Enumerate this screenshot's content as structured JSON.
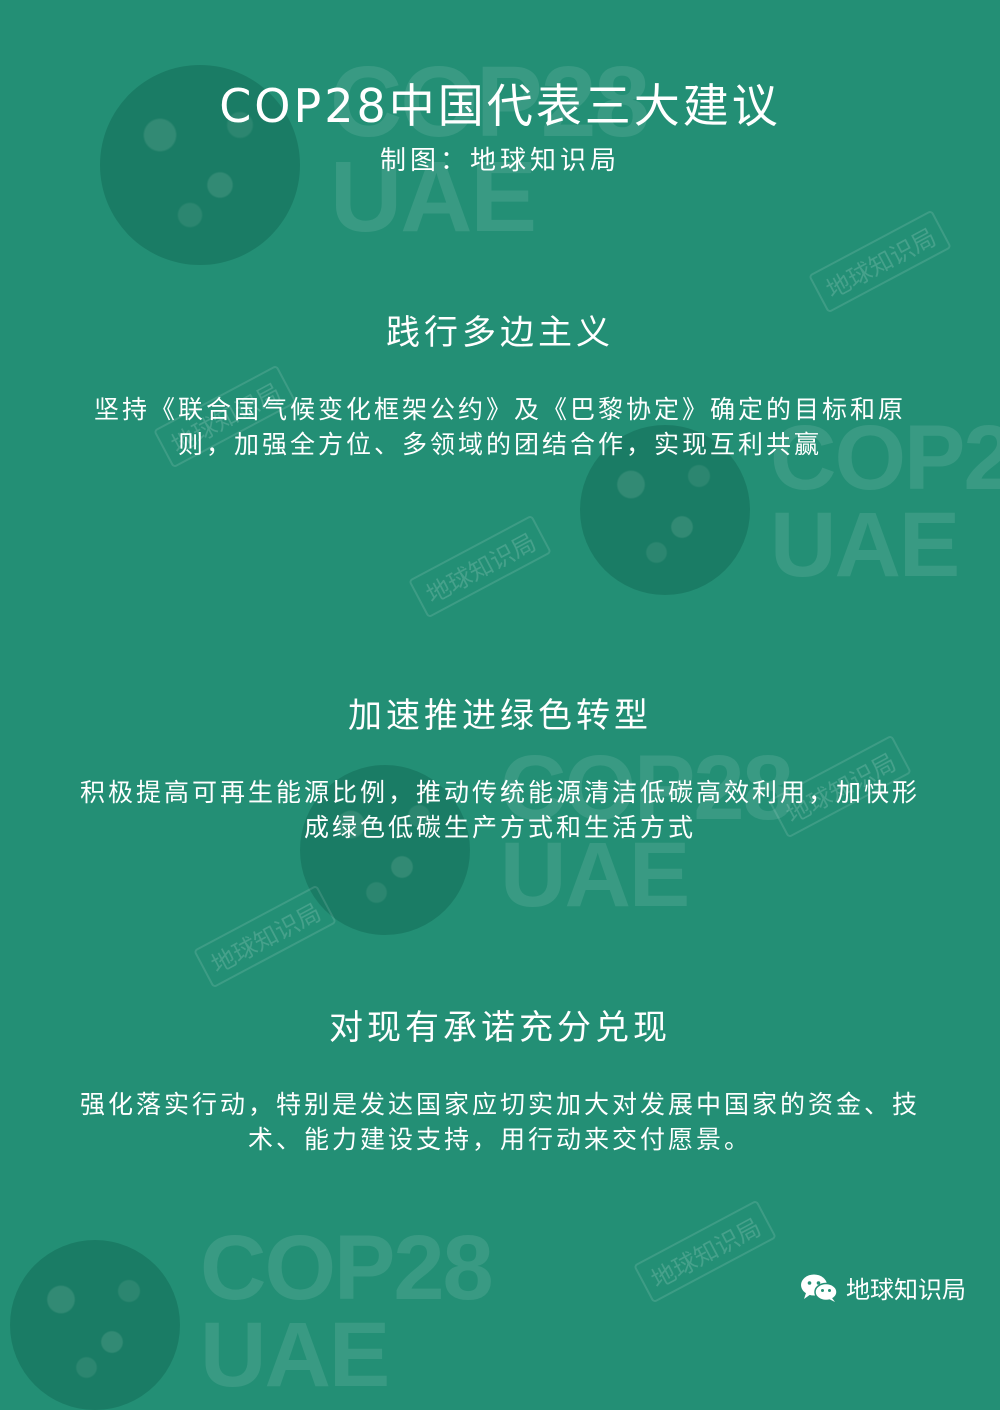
{
  "header": {
    "title": "COP28中国代表三大建议",
    "subtitle": "制图：地球知识局"
  },
  "sections": [
    {
      "heading": "践行多边主义",
      "body": "坚持《联合国气候变化框架公约》及《巴黎协定》确定的目标和原则，加强全方位、多领域的团结合作，实现互利共赢"
    },
    {
      "heading": "加速推进绿色转型",
      "body": "积极提高可再生能源比例，推动传统能源清洁低碳高效利用，加快形成绿色低碳生产方式和生活方式"
    },
    {
      "heading": "对现有承诺充分兑现",
      "body": "强化落实行动，特别是发达国家应切实加大对发展中国家的资金、技术、能力建设支持，用行动来交付愿景。"
    }
  ],
  "footer": {
    "icon": "wechat-icon",
    "label": "地球知识局"
  },
  "background": {
    "logo_text_line1": "COP28",
    "logo_text_line2": "UAE",
    "watermark": "地球知识局"
  },
  "colors": {
    "background": "#238f75",
    "text": "#ffffff"
  }
}
